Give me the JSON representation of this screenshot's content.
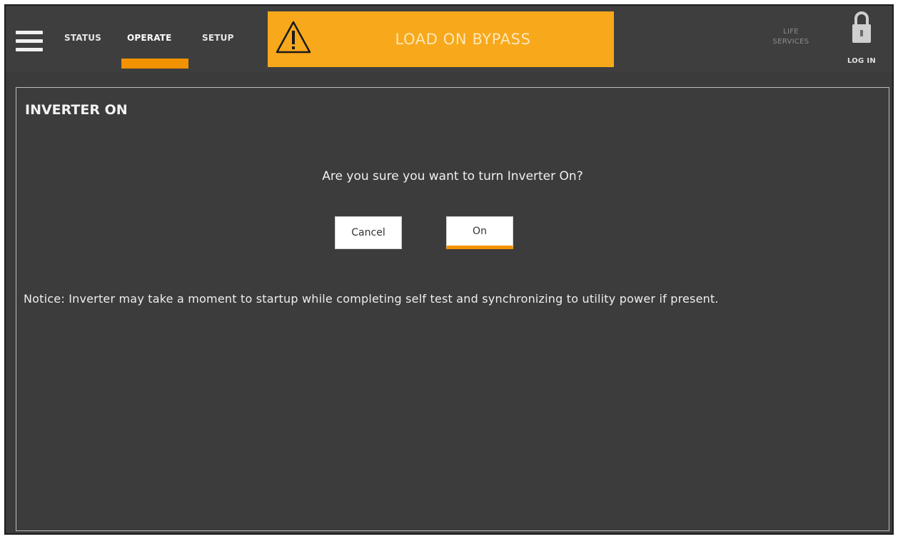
{
  "header": {
    "nav": {
      "status": "STATUS",
      "operate": "OPERATE",
      "setup": "SETUP",
      "active": "operate"
    },
    "alarm": {
      "text": "LOAD ON BYPASS",
      "icon": "warning-triangle-icon",
      "color": "#f7a81b"
    },
    "life_services": {
      "line1": "LIFE",
      "line2": "SERVICES"
    },
    "login": {
      "label": "LOG IN",
      "icon": "lock-icon"
    },
    "menu_icon": "hamburger-menu-icon"
  },
  "dialog": {
    "title": "INVERTER ON",
    "question": "Are you sure you want to turn Inverter On?",
    "buttons": {
      "cancel": "Cancel",
      "confirm": "On"
    },
    "notice": "Notice: Inverter may take a moment to startup while completing self test and synchronizing to utility power if present."
  },
  "colors": {
    "accent": "#f39200",
    "background": "#3b3b3b",
    "alarm": "#f7a81b"
  }
}
